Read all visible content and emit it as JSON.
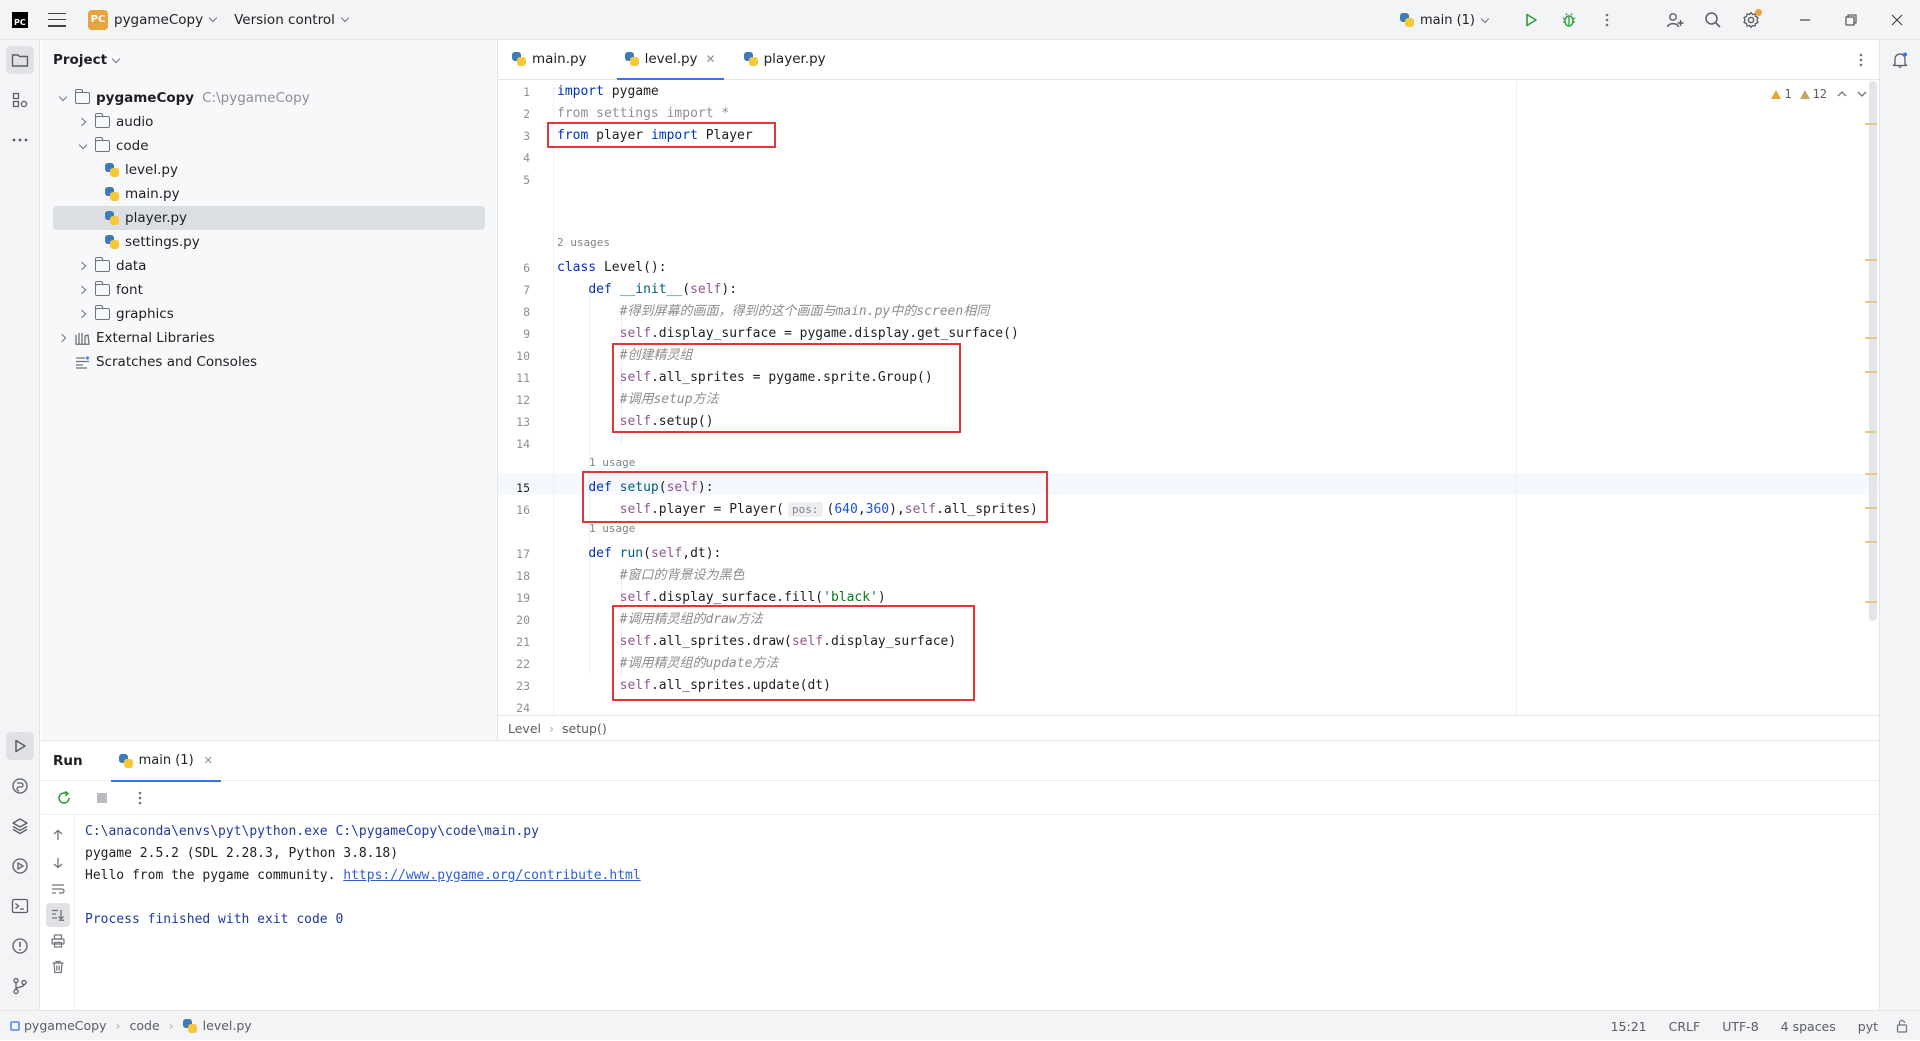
{
  "titlebar": {
    "logo": "PC",
    "project_badge": "PC",
    "project_name": "pygameCopy",
    "vcs_label": "Version control",
    "run_config": "main (1)"
  },
  "project_panel": {
    "title": "Project",
    "tree": [
      {
        "label": "pygameCopy",
        "hint": "C:\\pygameCopy",
        "kind": "folder",
        "depth": 0,
        "expanded": true
      },
      {
        "label": "audio",
        "kind": "folder",
        "depth": 1,
        "expanded": false
      },
      {
        "label": "code",
        "kind": "folder",
        "depth": 1,
        "expanded": true
      },
      {
        "label": "level.py",
        "kind": "py",
        "depth": 2
      },
      {
        "label": "main.py",
        "kind": "py",
        "depth": 2
      },
      {
        "label": "player.py",
        "kind": "py",
        "depth": 2,
        "selected": true
      },
      {
        "label": "settings.py",
        "kind": "py",
        "depth": 2
      },
      {
        "label": "data",
        "kind": "folder",
        "depth": 1,
        "expanded": false
      },
      {
        "label": "font",
        "kind": "folder",
        "depth": 1,
        "expanded": false
      },
      {
        "label": "graphics",
        "kind": "folder",
        "depth": 1,
        "expanded": false
      },
      {
        "label": "External Libraries",
        "kind": "lib",
        "depth": 0,
        "expanded": false
      },
      {
        "label": "Scratches and Consoles",
        "kind": "scratch",
        "depth": 0
      }
    ]
  },
  "editor": {
    "tabs": [
      {
        "label": "main.py",
        "active": false
      },
      {
        "label": "level.py",
        "active": true
      },
      {
        "label": "player.py",
        "active": false
      }
    ],
    "inspections": {
      "warnings": "1",
      "weak_warnings": "12"
    },
    "usage_hints": [
      "2 usages",
      "1 usage",
      "1 usage"
    ],
    "current_line": 15,
    "lines": [
      "import pygame",
      "from settings import *",
      "from player import Player",
      "",
      "",
      "class Level():",
      "    def __init__(self):",
      "        #得到屏幕的画面，得到的这个画面与main.py中的screen相同",
      "        self.display_surface = pygame.display.get_surface()",
      "        #创建精灵组",
      "        self.all_sprites = pygame.sprite.Group()",
      "        #调用setup方法",
      "        self.setup()",
      "",
      "    def setup(self):",
      "        self.player = Player( pos: (640,360),self.all_sprites)",
      "    def run(self,dt):",
      "        #窗口的背景设为黑色",
      "        self.display_surface.fill('black')",
      "        #调用精灵组的draw方法",
      "        self.all_sprites.draw(self.display_surface)",
      "        #调用精灵组的update方法",
      "        self.all_sprites.update(dt)",
      ""
    ],
    "breadcrumb": [
      "Level",
      "setup()"
    ]
  },
  "run_panel": {
    "title": "Run",
    "tab_label": "main (1)",
    "console": {
      "cmd": "C:\\anaconda\\envs\\pyt\\python.exe C:\\pygameCopy\\code\\main.py",
      "line2": "pygame 2.5.2 (SDL 2.28.3, Python 3.8.18)",
      "line3_text": "Hello from the pygame community. ",
      "line3_link": "https://www.pygame.org/contribute.html",
      "finished": "Process finished with exit code 0"
    }
  },
  "statusbar": {
    "path": [
      "pygameCopy",
      "code",
      "level.py"
    ],
    "position": "15:21",
    "line_sep": "CRLF",
    "encoding": "UTF-8",
    "indent": "4 spaces",
    "interpreter": "pyt"
  },
  "colors": {
    "accent": "#3574f0",
    "highlight_box": "#e23636",
    "keyword": "#0033b3",
    "self": "#94558d",
    "number": "#1750eb",
    "string": "#067d17"
  }
}
